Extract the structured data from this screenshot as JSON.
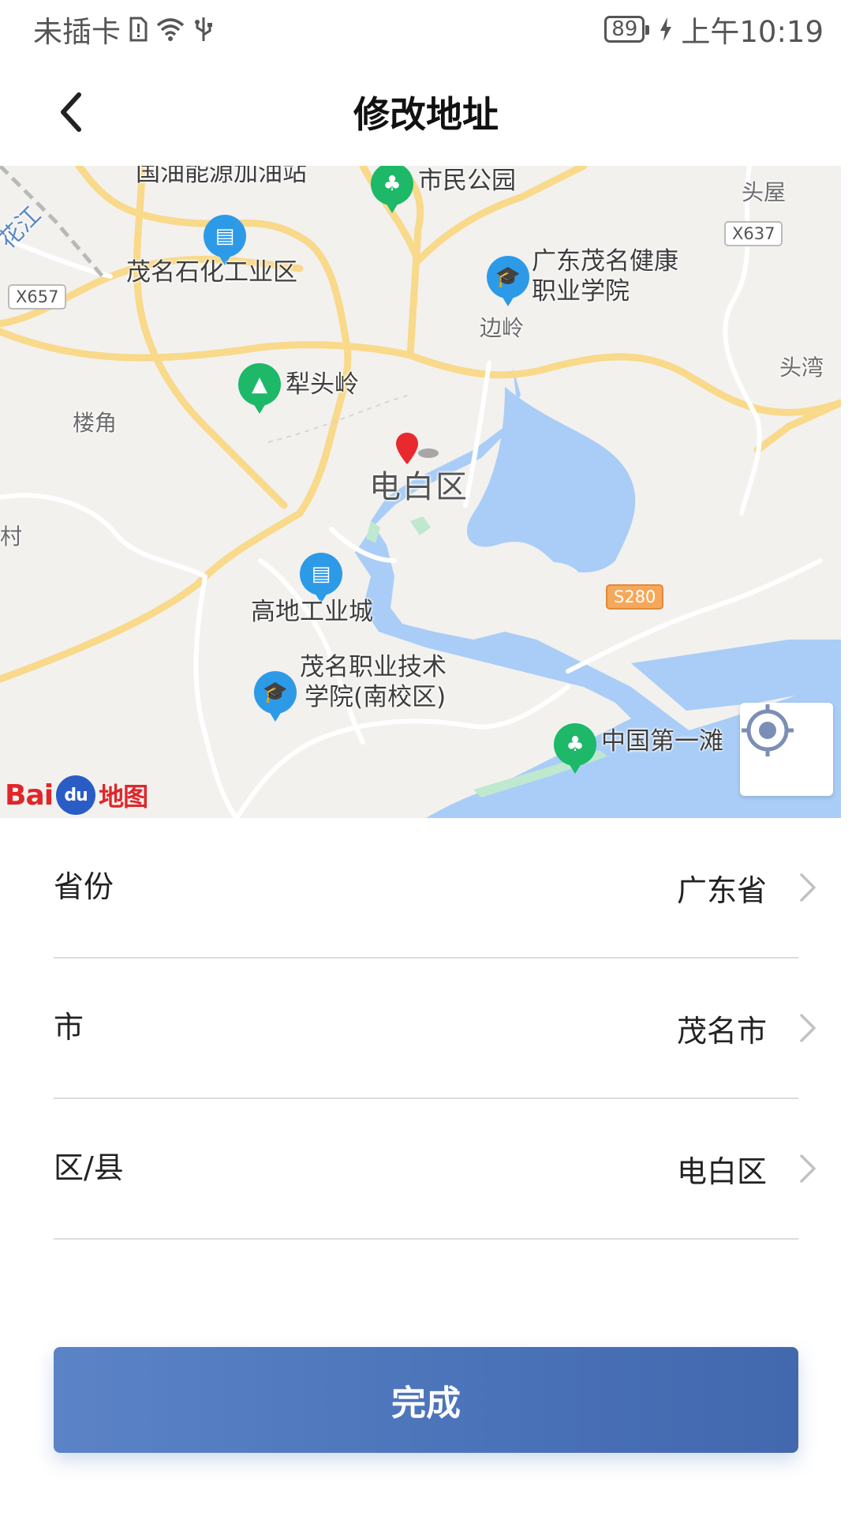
{
  "status_bar": {
    "carrier": "未插卡",
    "battery": "89",
    "time": "上午10:19"
  },
  "header": {
    "title": "修改地址"
  },
  "map": {
    "labels": {
      "gas_station": "国油能源加油站",
      "park": "市民公园",
      "village_touwu": "头屋",
      "road_x637": "X637",
      "river": "花江",
      "industrial_zone": "茂名石化工业区",
      "health_college_1": "广东茂名健康",
      "health_college_2": "职业学院",
      "road_x657": "X657",
      "bianling": "边岭",
      "toutou_bay": "头湾",
      "litouling": "犁头岭",
      "loujiao": "楼角",
      "district": "电白区",
      "village": "村",
      "road_s280": "S280",
      "gaodi": "高地工业城",
      "tech_college_1": "茂名职业技术",
      "tech_college_2": "学院(南校区)",
      "first_beach": "中国第一滩"
    },
    "logo": {
      "bai": "Bai",
      "du": "du",
      "suffix": "地图"
    }
  },
  "form": {
    "rows": [
      {
        "label": "省份",
        "value": "广东省"
      },
      {
        "label": "市",
        "value": "茂名市"
      },
      {
        "label": "区/县",
        "value": "电白区"
      }
    ]
  },
  "done_button": {
    "label": "完成"
  },
  "colors": {
    "accent": "#4a72b8",
    "map_water": "#a9cdf7",
    "map_road": "#f9d98a",
    "pin_red": "#e8292e"
  }
}
